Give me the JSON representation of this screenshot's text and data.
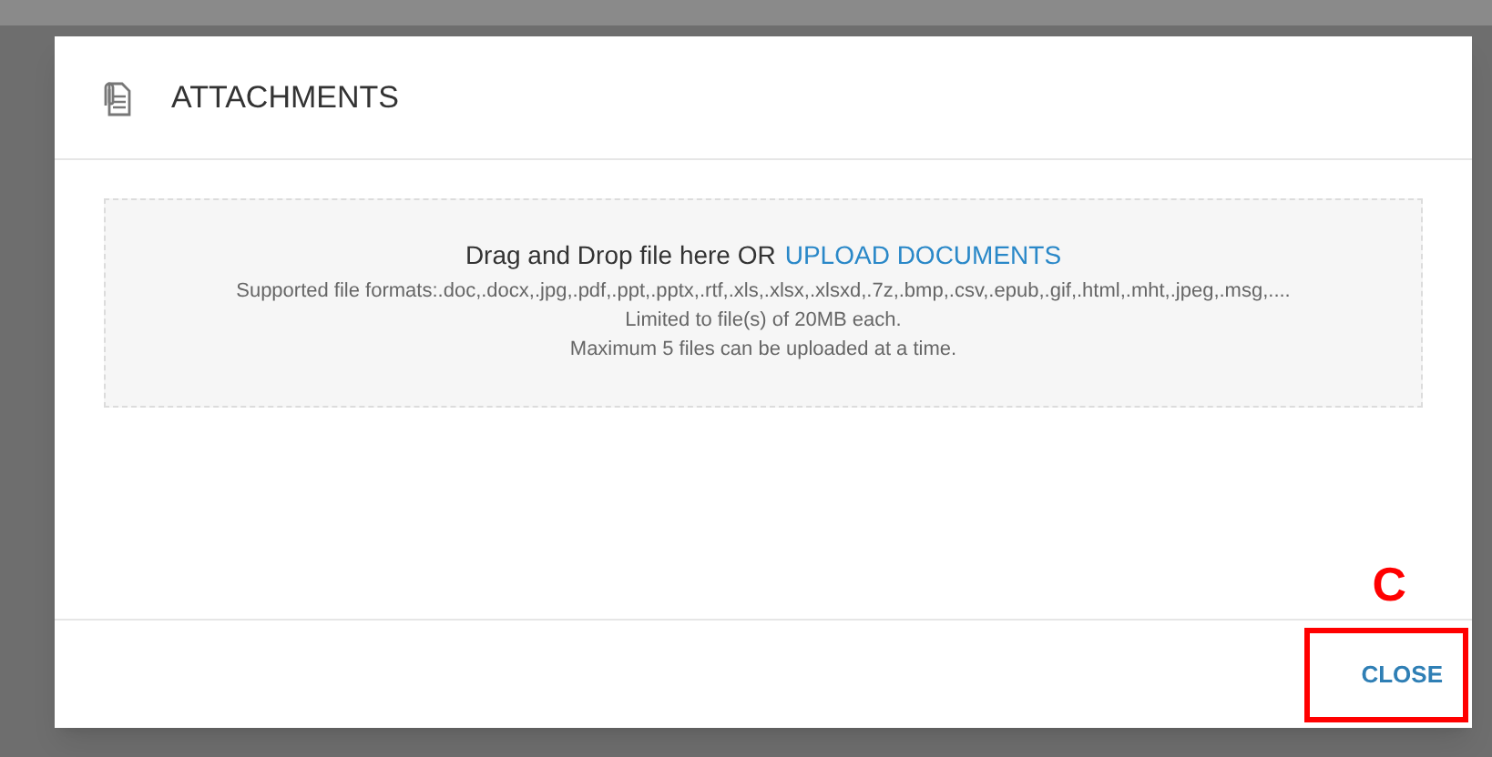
{
  "dialog": {
    "title": "ATTACHMENTS",
    "drop_zone": {
      "prompt": "Drag and Drop file here OR",
      "link": "UPLOAD DOCUMENTS",
      "lines": [
        "Supported file formats:.doc,.docx,.jpg,.pdf,.ppt,.pptx,.rtf,.xls,.xlsx,.xlsxd,.7z,.bmp,.csv,.epub,.gif,.html,.mht,.jpeg,.msg,....",
        "Limited to file(s) of 20MB each.",
        "Maximum 5 files can be uploaded at a time."
      ]
    },
    "buttons": [
      "CLOSE"
    ]
  },
  "annotation": {
    "label": "C"
  }
}
